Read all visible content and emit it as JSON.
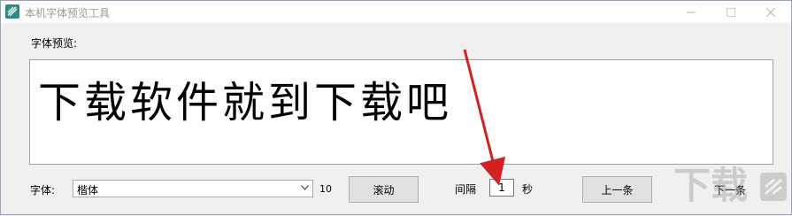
{
  "window": {
    "title": "本机字体预览工具",
    "icon": "app-icon",
    "controls": [
      "minimize-icon",
      "maximize-icon",
      "close-icon"
    ]
  },
  "preview": {
    "label": "字体预览:",
    "sample_text": "下载软件就到下载吧"
  },
  "controls": {
    "font_label": "字体:",
    "font_selected": "楷体",
    "font_size": "10",
    "scroll_button": "滚动",
    "interval_label": "间隔",
    "interval_value": "1",
    "seconds_label": "秒",
    "prev_button": "上一条",
    "next_button": "下一条"
  },
  "annotation": {
    "arrow_color": "#d32020"
  },
  "watermark": {
    "text": "下载"
  }
}
